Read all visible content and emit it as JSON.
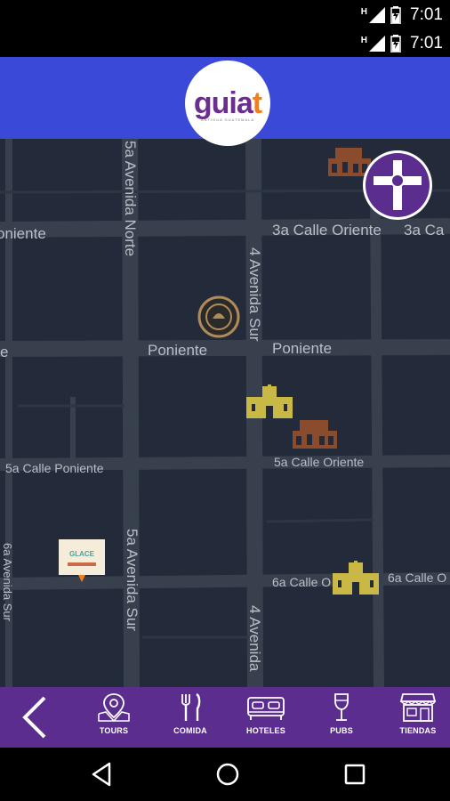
{
  "status_bars": [
    {
      "time": "7:01",
      "signal": "H"
    },
    {
      "time": "7:01",
      "signal": "H"
    }
  ],
  "header": {
    "logo_main": "guia",
    "logo_accent": "t",
    "logo_tagline": "ANTIGUA GUATEMALA"
  },
  "map": {
    "streets": [
      {
        "name": "5a Avenida Norte"
      },
      {
        "name": "4 Avenida Sur"
      },
      {
        "name": "3a Calle Oriente"
      },
      {
        "name": "3a Ca"
      },
      {
        "name": "oniente"
      },
      {
        "name": "Poniente"
      },
      {
        "name": "Poniente"
      },
      {
        "name": "e"
      },
      {
        "name": "5a Calle Poniente"
      },
      {
        "name": "5a Calle Oriente"
      },
      {
        "name": "5a Avenida Sur"
      },
      {
        "name": "6a Avenida Sur"
      },
      {
        "name": "6a Calle O"
      },
      {
        "name": "6a Calle O"
      },
      {
        "name": "4 Avenida"
      }
    ],
    "markers": [
      {
        "type": "museum-marker",
        "icon": "museum-icon"
      },
      {
        "type": "church-cross-marker",
        "icon": "cross-icon"
      },
      {
        "type": "restaurant-badge-marker",
        "icon": "restaurant-logo-icon"
      },
      {
        "type": "church-marker",
        "icon": "church-icon"
      },
      {
        "type": "museum-marker",
        "icon": "museum-icon"
      },
      {
        "type": "church-marker",
        "icon": "church-icon"
      },
      {
        "type": "shop-marker",
        "icon": "shop-logo-icon",
        "label": "GLACE"
      }
    ],
    "colors": {
      "background": "#232b3a",
      "road": "#38404e",
      "label": "#b9bec8",
      "church": "#c9b845",
      "museum": "#8a4c2c",
      "cross_marker": "#5b2d8e"
    }
  },
  "bottom_nav": {
    "back_icon": "chevron-left-icon",
    "items": [
      {
        "label": "TOURS",
        "icon": "map-pin-icon"
      },
      {
        "label": "COMIDA",
        "icon": "fork-knife-icon"
      },
      {
        "label": "HOTELES",
        "icon": "bed-icon"
      },
      {
        "label": "PUBS",
        "icon": "wine-glass-icon"
      },
      {
        "label": "TIENDAS",
        "icon": "storefront-icon"
      }
    ],
    "background": "#5b2d8e"
  },
  "android_nav": {
    "back_icon": "triangle-back-icon",
    "home_icon": "circle-home-icon",
    "recents_icon": "square-recents-icon"
  }
}
